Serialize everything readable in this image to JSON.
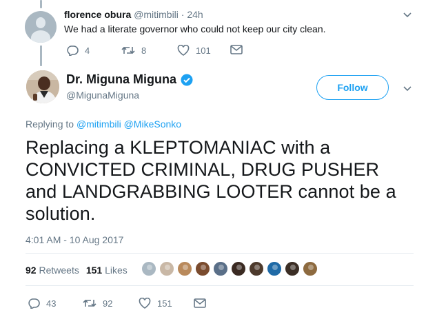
{
  "reply": {
    "name": "florence obura",
    "handle": "@mitimbili",
    "separator": " · ",
    "time": "24h",
    "text": "We had a literate governor who could not keep our city clean.",
    "replies": "4",
    "retweets": "8",
    "likes": "101"
  },
  "tweet": {
    "author_name": "Dr. Miguna Miguna",
    "author_handle": "@MigunaMiguna",
    "follow_label": "Follow",
    "replying_prefix": "Replying to ",
    "replying_to": [
      "@mitimbili",
      "@MikeSonko"
    ],
    "text": "Replacing a KLEPTOMANIAC with a CONVICTED CRIMINAL, DRUG PUSHER and LANDGRABBING LOOTER cannot be a solution.",
    "timestamp": "4:01 AM - 10 Aug 2017",
    "retweet_count": "92",
    "retweet_label": "Retweets",
    "like_count": "151",
    "like_label": "Likes",
    "replies": "43",
    "retweets": "92",
    "likes": "151"
  },
  "colors": {
    "accent": "#1da1f2",
    "verified": "#1da1f2",
    "muted": "#657786",
    "text": "#14171a"
  },
  "icons": [
    "reply-icon",
    "retweet-icon",
    "like-icon",
    "message-icon",
    "chevron-down-icon",
    "verified-badge-icon"
  ],
  "likers": [
    {
      "color": "#aab8c2"
    },
    {
      "color": "#c9b8a6"
    },
    {
      "color": "#b98a5c"
    },
    {
      "color": "#7a4b2e"
    },
    {
      "color": "#5a6f88"
    },
    {
      "color": "#3a2a22"
    },
    {
      "color": "#4d3a2c"
    },
    {
      "color": "#1f6aa6"
    },
    {
      "color": "#3b2e25"
    },
    {
      "color": "#8d6a3f"
    }
  ]
}
